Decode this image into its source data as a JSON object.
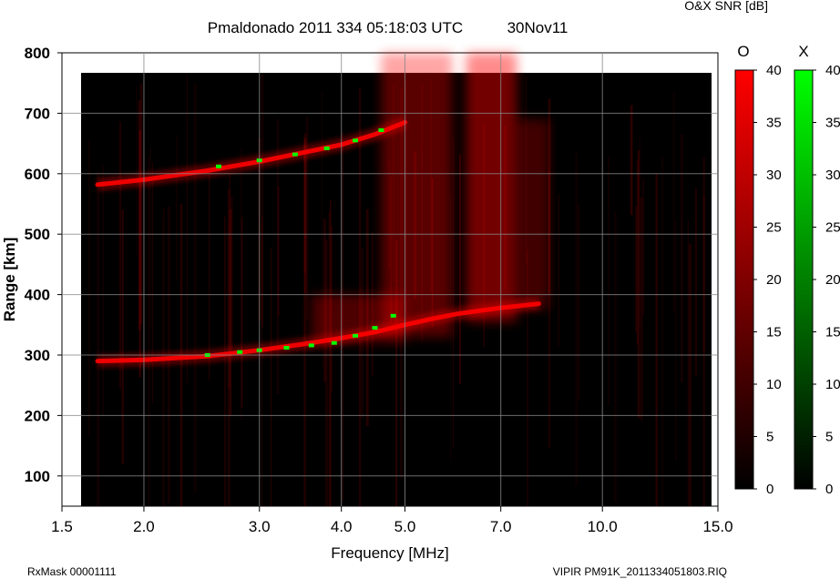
{
  "header": {
    "title": "Pmaldonado 2011 334 05:18:03 UTC",
    "date": "30Nov11",
    "colorbar_caption": "O&X SNR [dB]"
  },
  "footer": {
    "rxmask": "RxMask 00001111",
    "file": "VIPIR  PM91K_2011334051803.RIQ"
  },
  "colors": {
    "background": "#000000",
    "o_mode": "#ff0000",
    "x_mode": "#00ff00"
  },
  "chart_data": {
    "type": "heatmap",
    "title": "Pmaldonado 2011 334 05:18:03 UTC",
    "xlabel": "Frequency [MHz]",
    "ylabel": "Range [km]",
    "x_scale": "log",
    "xlim": [
      1.5,
      15.0
    ],
    "ylim": [
      50,
      800
    ],
    "x_ticks": [
      1.5,
      2.0,
      3.0,
      4.0,
      5.0,
      7.0,
      10.0,
      15.0
    ],
    "x_tick_labels": [
      "1.5",
      "2.0",
      "3.0",
      "4.0",
      "5.0",
      "7.0",
      "10.0",
      "15.0"
    ],
    "y_ticks": [
      100,
      200,
      300,
      400,
      500,
      600,
      700,
      800
    ],
    "y_tick_labels": [
      "100",
      "200",
      "300",
      "400",
      "500",
      "600",
      "700",
      "800"
    ],
    "grid": true,
    "colorbars": [
      {
        "name": "O",
        "unit": "dB",
        "range": [
          0,
          40
        ],
        "ticks": [
          0,
          5,
          10,
          15,
          20,
          25,
          30,
          35,
          40
        ],
        "colormap": "black-to-red"
      },
      {
        "name": "X",
        "unit": "dB",
        "range": [
          0,
          40
        ],
        "ticks": [
          0,
          5,
          10,
          15,
          20,
          25,
          30,
          35,
          40
        ],
        "colormap": "black-to-green"
      }
    ],
    "series": [
      {
        "name": "O",
        "mode": "first hop",
        "x": [
          1.7,
          2.0,
          2.5,
          3.0,
          3.5,
          4.0,
          4.5,
          5.0,
          5.5,
          6.0,
          7.0,
          8.0
        ],
        "y": [
          290,
          292,
          298,
          308,
          318,
          328,
          338,
          350,
          360,
          368,
          378,
          385
        ]
      },
      {
        "name": "O",
        "mode": "second hop",
        "x": [
          1.7,
          2.0,
          2.5,
          3.0,
          3.5,
          4.0,
          4.5,
          5.0
        ],
        "y": [
          582,
          590,
          605,
          620,
          635,
          648,
          665,
          685
        ]
      },
      {
        "name": "X",
        "mode": "first hop",
        "x": [
          2.5,
          2.8,
          3.0,
          3.3,
          3.6,
          3.9,
          4.2,
          4.5,
          4.8
        ],
        "y": [
          300,
          305,
          308,
          312,
          316,
          320,
          332,
          345,
          365
        ]
      },
      {
        "name": "X",
        "mode": "second hop",
        "x": [
          2.6,
          3.0,
          3.4,
          3.8,
          4.2,
          4.6
        ],
        "y": [
          612,
          622,
          632,
          642,
          655,
          672
        ]
      }
    ]
  }
}
